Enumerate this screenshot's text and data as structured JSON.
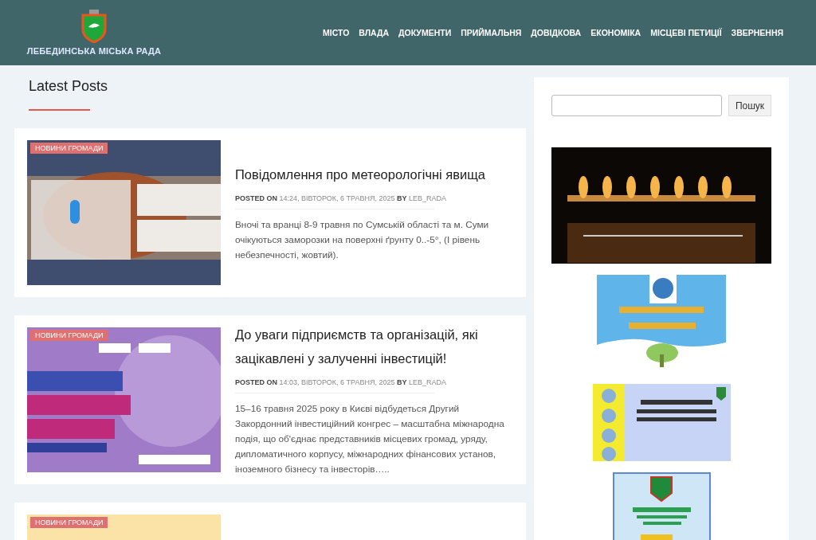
{
  "header": {
    "site_name": "ЛЕБЕДИНСЬКА МІСЬКА РАДА",
    "nav": [
      "МІСТО",
      "ВЛАДА",
      "ДОКУМЕНТИ",
      "ПРИЙМАЛЬНЯ",
      "ДОВІДКОВА",
      "ЕКОНОМІКА",
      "МІСЦЕВІ ПЕТИЦІЇ",
      "ЗВЕРНЕННЯ"
    ]
  },
  "main": {
    "heading": "Latest Posts",
    "posts": [
      {
        "category": "НОВИНИ ГРОМАДИ",
        "kind": "weather",
        "title": "Повідомлення про метеорологічні явища",
        "posted_label": "POSTED ON",
        "date": "14:24, ВІВТОРОК, 6 ТРАВНЯ, 2025",
        "by_label": "BY",
        "author": "LEB_RADA",
        "excerpt": "Вночі та вранці 8-9 травня по Сумській області та м. Суми очікуються заморозки на поверхні ґрунту 0..-5°, (І рівень небезпечності, жовтий)."
      },
      {
        "category": "НОВИНИ ГРОМАДИ",
        "kind": "congress",
        "title": "До уваги підприємств та організацій, які зацікавлені у залученні інвестицій!",
        "posted_label": "POSTED ON",
        "date": "14:03, ВІВТОРОК, 6 ТРАВНЯ, 2025",
        "by_label": "BY",
        "author": "LEB_RADA",
        "excerpt": "15–16 травня 2025 року в Києві відбудеться Другий Закордонний інвестиційний конгрес – масштабна міжнародна подія, що об'єднає представників місцевих громад, уряду, дипломатичного корпусу, міжнародних фінансових установ, іноземного бізнесу та інвесторів….."
      },
      {
        "category": "НОВИНИ ГРОМАДИ",
        "kind": "partial"
      }
    ]
  },
  "sidebar": {
    "search_button": "Пошук",
    "banners": [
      {
        "kind": "candles"
      },
      {
        "kind": "globe"
      },
      {
        "kind": "ornament"
      },
      {
        "kind": "crest"
      }
    ]
  }
}
